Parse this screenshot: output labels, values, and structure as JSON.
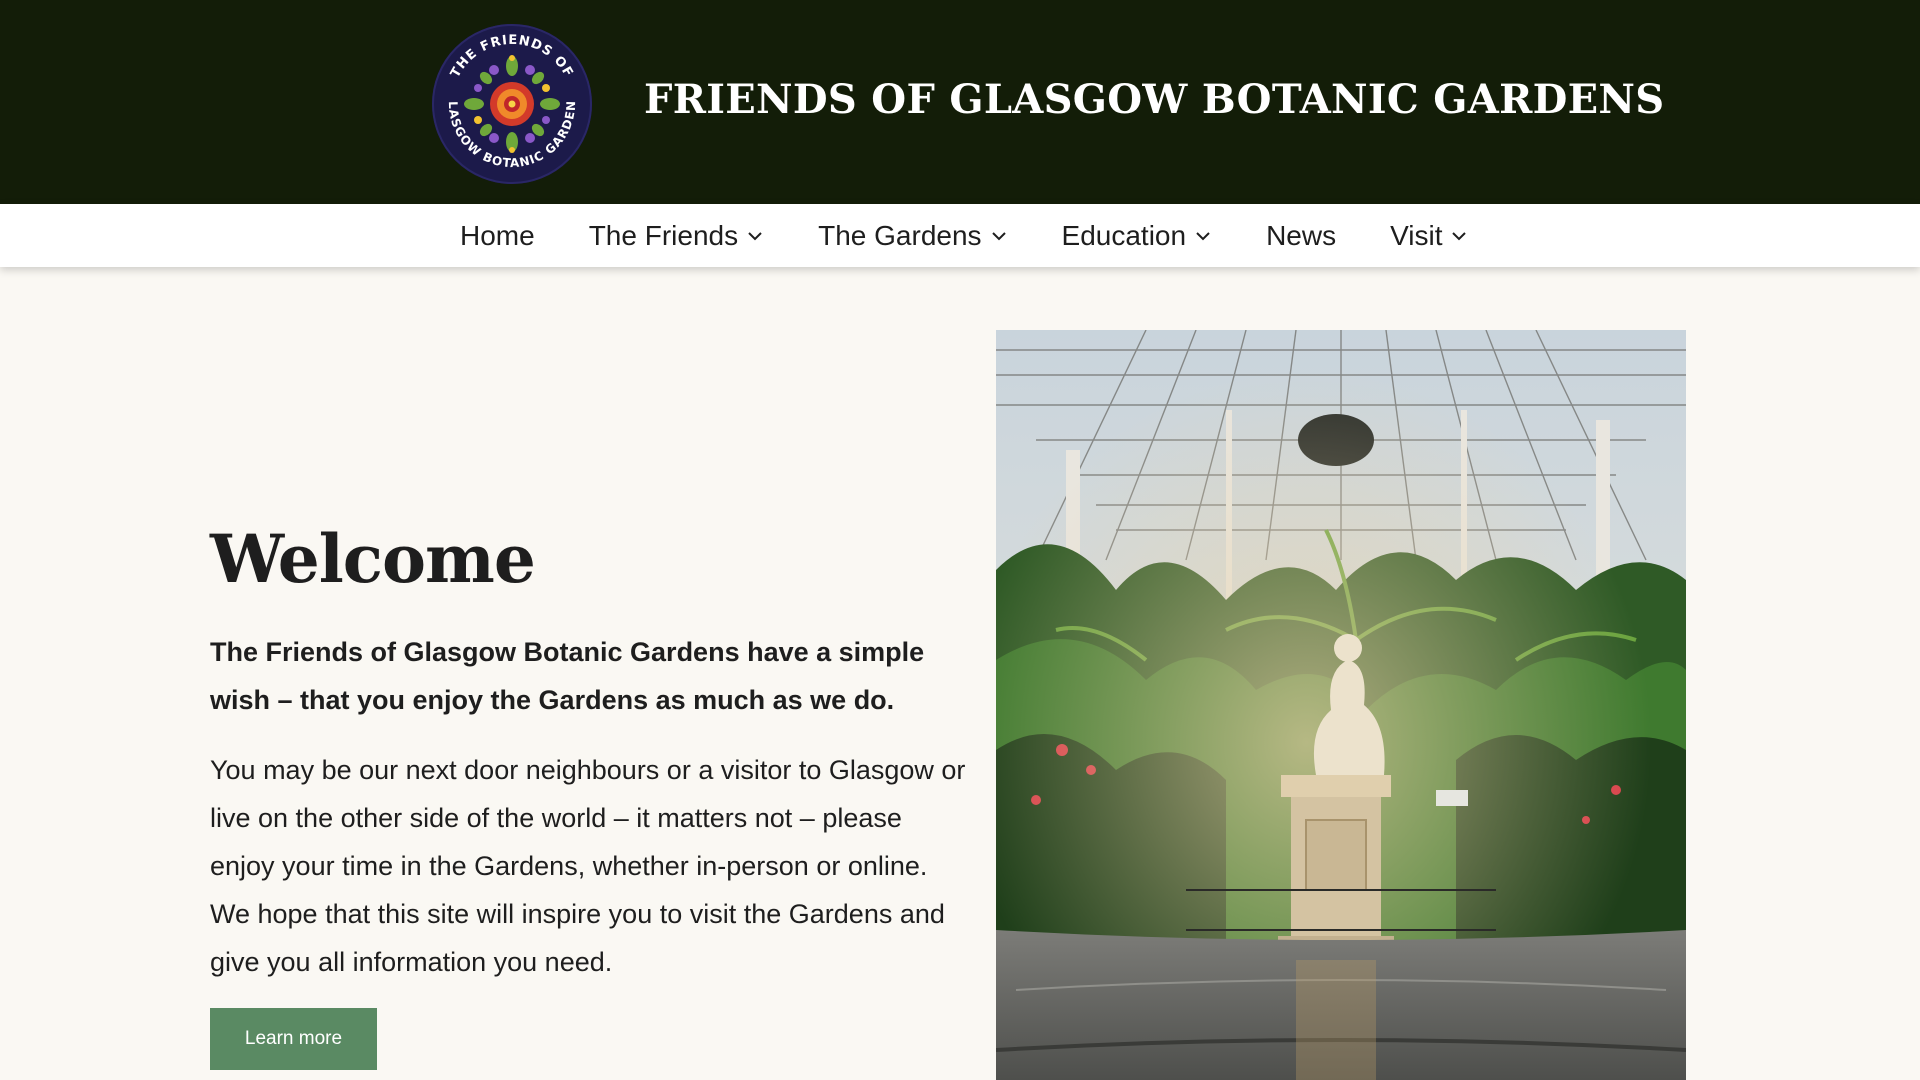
{
  "header": {
    "site_title": "FRIENDS OF GLASGOW BOTANIC GARDENS",
    "logo": {
      "icon": "circular-floral-emblem",
      "ring_text_top": "THE FRIENDS OF",
      "ring_text_bottom": "GLASGOW BOTANIC GARDENS"
    }
  },
  "nav": {
    "items": [
      {
        "label": "Home",
        "has_dropdown": false
      },
      {
        "label": "The Friends",
        "has_dropdown": true
      },
      {
        "label": "The Gardens",
        "has_dropdown": true
      },
      {
        "label": "Education",
        "has_dropdown": true
      },
      {
        "label": "News",
        "has_dropdown": false
      },
      {
        "label": "Visit",
        "has_dropdown": true
      }
    ]
  },
  "main": {
    "heading": "Welcome",
    "lead": "The Friends of Glasgow Botanic Gardens have a simple wish – that you enjoy the Gardens as much as we do.",
    "body": "You may be our next door neighbours or a visitor to Glasgow or  live on the other side of the world – it matters not – please enjoy your time in the Gardens, whether in-person or online. We hope that this site will inspire you to visit the Gardens and give you all information you need.",
    "button_label": "Learn more"
  },
  "hero_image": {
    "subject": "glasshouse-dome-with-marble-statue"
  },
  "colors": {
    "header_bg": "#131d08",
    "nav_bg": "#ffffff",
    "page_bg": "#faf8f3",
    "button_bg": "#5a8a63",
    "text": "#1e1e1e"
  }
}
